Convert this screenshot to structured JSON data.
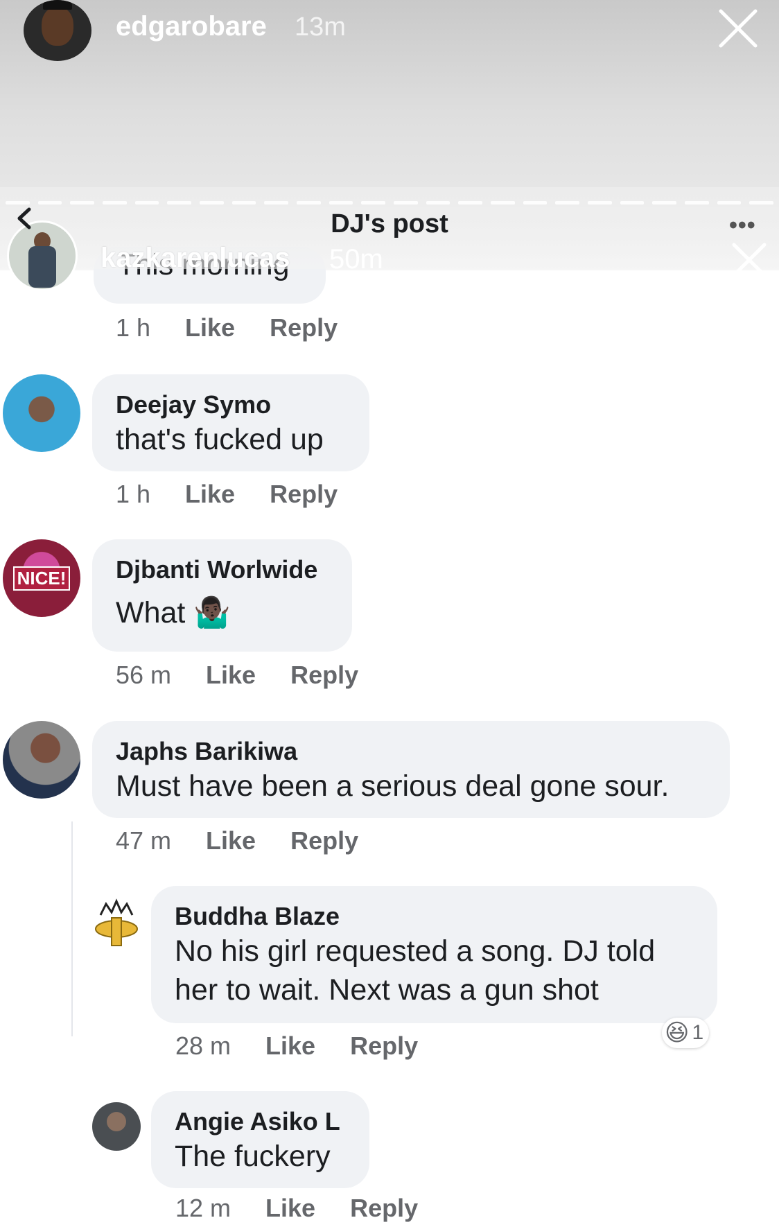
{
  "story": {
    "username": "edgarobare",
    "time": "13m"
  },
  "inner_story": {
    "username": "kazkarenlucas",
    "time": "50m"
  },
  "post": {
    "title": "DJ's post",
    "more": "•••"
  },
  "comments": [
    {
      "name": "",
      "text": "This morning",
      "time": "1 h",
      "like": "Like",
      "reply": "Reply"
    },
    {
      "name": "Deejay Symo",
      "text": "that's fucked up",
      "time": "1 h",
      "like": "Like",
      "reply": "Reply"
    },
    {
      "name": "Djbanti Worlwide",
      "text": "What 🤷🏿‍♂️",
      "time": "56 m",
      "like": "Like",
      "reply": "Reply",
      "avatar_text": "NICE!"
    },
    {
      "name": "Japhs Barikiwa",
      "text": "Must have been a serious deal gone sour.",
      "time": "47 m",
      "like": "Like",
      "reply": "Reply"
    },
    {
      "name": "Buddha Blaze",
      "text": "No his girl requested a song. DJ told her to wait. Next was a gun shot",
      "time": "28 m",
      "like": "Like",
      "reply": "Reply",
      "reaction_emoji": "😆",
      "reaction_count": "1"
    },
    {
      "name": "Angie Asiko L",
      "text": "The fuckery",
      "time": "12 m",
      "like": "Like",
      "reply": "Reply"
    }
  ],
  "colors": {
    "bubble": "#f0f2f5",
    "meta": "#65676b",
    "text": "#1c1e21"
  }
}
